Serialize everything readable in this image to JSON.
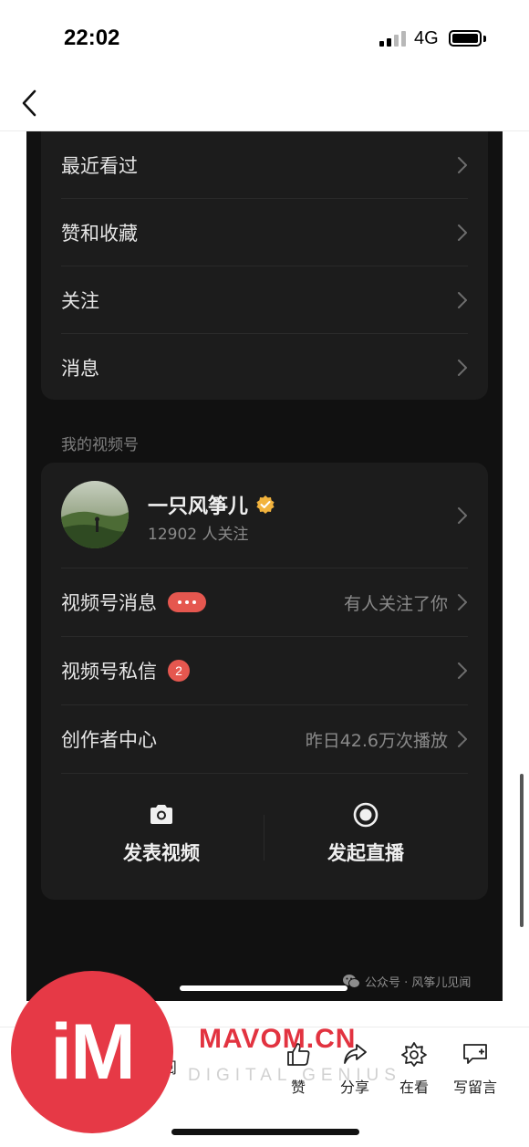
{
  "status_bar": {
    "time": "22:02",
    "network": "4G"
  },
  "menu": [
    {
      "label": "最近看过"
    },
    {
      "label": "赞和收藏"
    },
    {
      "label": "关注"
    },
    {
      "label": "消息"
    }
  ],
  "channel_section": {
    "title": "我的视频号",
    "profile": {
      "name": "一只风筝儿",
      "followers": "12902 人关注"
    },
    "rows": [
      {
        "label": "视频号消息",
        "badge": "dots",
        "right_text": "有人关注了你"
      },
      {
        "label": "视频号私信",
        "badge_count": "2",
        "right_text": ""
      },
      {
        "label": "创作者中心",
        "right_text": "昨日42.6万次播放"
      }
    ],
    "actions": {
      "publish_video": "发表视频",
      "start_live": "发起直播"
    }
  },
  "watermark": "公众号 · 风筝儿见闻",
  "toolbar": {
    "partial_label": "阅",
    "like": "赞",
    "share": "分享",
    "watching": "在看",
    "comment": "写留言"
  },
  "overlay": {
    "logo_text": "iM",
    "brand": "MAVOM.CN",
    "tagline": "DIGITAL GENIUS",
    "brand_color": "#e23340"
  },
  "colors": {
    "dark_bg": "#111111",
    "card_bg": "#1c1c1c",
    "badge_red": "#e5574f",
    "verified_gold": "#f2b33d"
  }
}
